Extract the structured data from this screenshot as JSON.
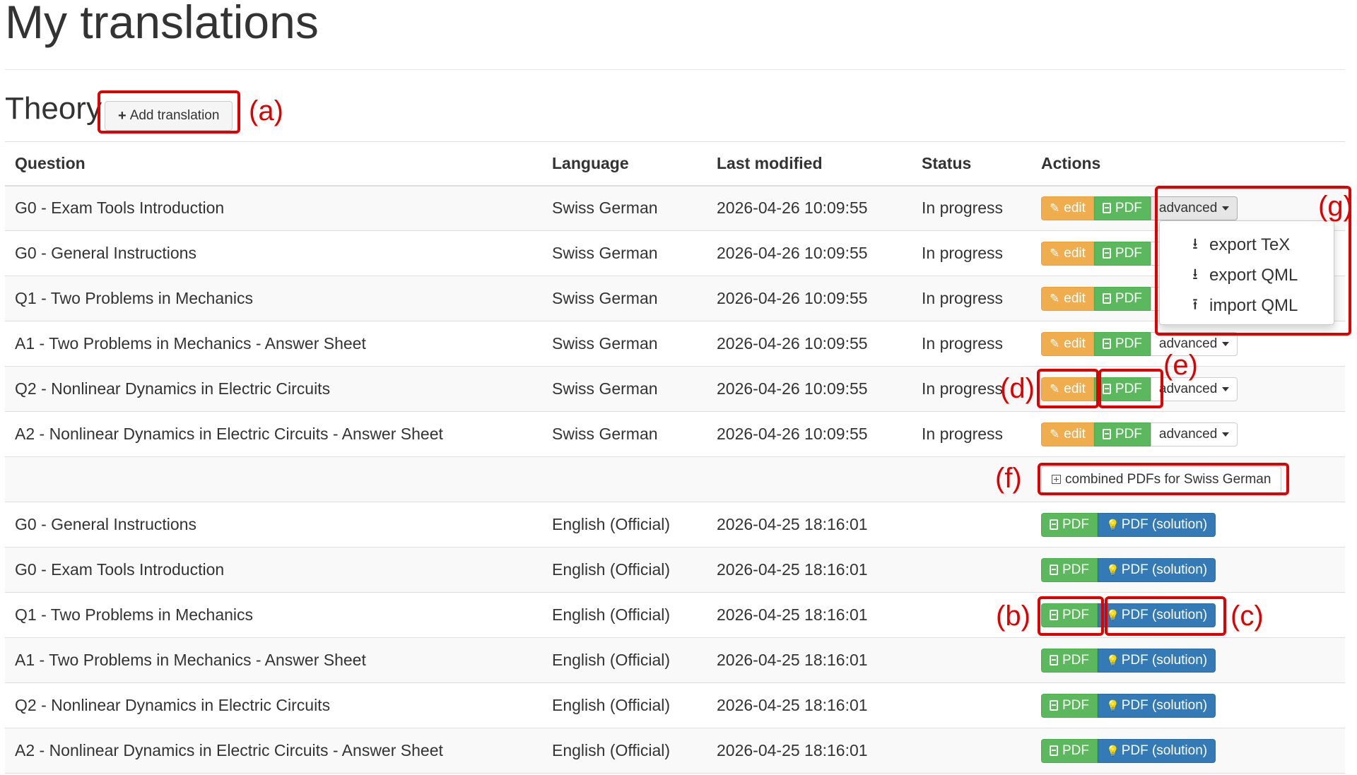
{
  "page": {
    "title": "My translations"
  },
  "section": {
    "title": "Theory",
    "add_button_label": "Add translation"
  },
  "table": {
    "headers": [
      "Question",
      "Language",
      "Last modified",
      "Status",
      "Actions"
    ]
  },
  "rows_own": [
    {
      "question": "G0 - Exam Tools Introduction",
      "language": "Swiss German",
      "modified": "2026-04-26 10:09:55",
      "status": "In progress"
    },
    {
      "question": "G0 - General Instructions",
      "language": "Swiss German",
      "modified": "2026-04-26 10:09:55",
      "status": "In progress"
    },
    {
      "question": "Q1 - Two Problems in Mechanics",
      "language": "Swiss German",
      "modified": "2026-04-26 10:09:55",
      "status": "In progress"
    },
    {
      "question": "A1 - Two Problems in Mechanics - Answer Sheet",
      "language": "Swiss German",
      "modified": "2026-04-26 10:09:55",
      "status": "In progress"
    },
    {
      "question": "Q2 - Nonlinear Dynamics in Electric Circuits",
      "language": "Swiss German",
      "modified": "2026-04-26 10:09:55",
      "status": "In progress"
    },
    {
      "question": "A2 - Nonlinear Dynamics in Electric Circuits - Answer Sheet",
      "language": "Swiss German",
      "modified": "2026-04-26 10:09:55",
      "status": "In progress"
    }
  ],
  "own_actions": {
    "edit": "edit",
    "pdf": "PDF",
    "advanced": "advanced"
  },
  "combined_label": "combined PDFs for Swiss German",
  "rows_official": [
    {
      "question": "G0 - General Instructions",
      "language": "English (Official)",
      "modified": "2026-04-25 18:16:01"
    },
    {
      "question": "G0 - Exam Tools Introduction",
      "language": "English (Official)",
      "modified": "2026-04-25 18:16:01"
    },
    {
      "question": "Q1 - Two Problems in Mechanics",
      "language": "English (Official)",
      "modified": "2026-04-25 18:16:01"
    },
    {
      "question": "A1 - Two Problems in Mechanics - Answer Sheet",
      "language": "English (Official)",
      "modified": "2026-04-25 18:16:01"
    },
    {
      "question": "Q2 - Nonlinear Dynamics in Electric Circuits",
      "language": "English (Official)",
      "modified": "2026-04-25 18:16:01"
    },
    {
      "question": "A2 - Nonlinear Dynamics in Electric Circuits - Answer Sheet",
      "language": "English (Official)",
      "modified": "2026-04-25 18:16:01"
    }
  ],
  "official_actions": {
    "pdf": "PDF",
    "solution": "PDF (solution)"
  },
  "dropdown": {
    "items": [
      "export TeX",
      "export QML",
      "import QML"
    ]
  },
  "annotations": [
    "(a)",
    "(b)",
    "(c)",
    "(d)",
    "(e)",
    "(f)",
    "(g)"
  ],
  "colors": {
    "edit": "#f0ad4e",
    "pdf": "#5cb85c",
    "solution": "#337ab7",
    "annotation": "#e00000"
  },
  "icons": {
    "add": "plus-icon",
    "edit": "pencil-icon",
    "pdf": "file-pdf-icon",
    "solution": "lightbulb-icon",
    "combined": "plus-square-icon",
    "export": "download-icon",
    "import": "upload-icon"
  }
}
